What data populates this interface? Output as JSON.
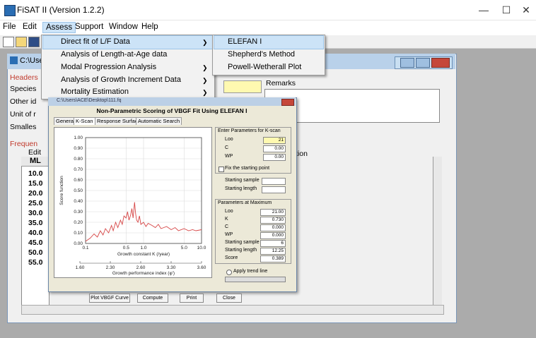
{
  "window": {
    "title": "FiSAT II (Version 1.2.2)",
    "minimize": "—",
    "maximize": "☐",
    "close": "✕"
  },
  "menubar": [
    "File",
    "Edit",
    "Assess",
    "Support",
    "Window",
    "Help"
  ],
  "assess_menu": [
    {
      "label": "Direct fit of L/F Data",
      "submenu": true
    },
    {
      "label": "Analysis of Length-at-Age data",
      "submenu": false
    },
    {
      "label": "Modal Progression Analysis",
      "submenu": true
    },
    {
      "label": "Analysis of Growth Increment Data",
      "submenu": true
    },
    {
      "label": "Mortality Estimation",
      "submenu": true
    }
  ],
  "direct_fit_submenu": [
    "ELEFAN I",
    "Shepherd's Method",
    "Powell-Wetherall Plot"
  ],
  "child": {
    "title": "C:\\Use",
    "headers_label": "Headers",
    "species_label": "Species",
    "other_label": "Other id",
    "unit_label": "Unit of r",
    "smallest_label": "Smalles",
    "remarks_label": "Remarks",
    "frequency_label": "Frequen",
    "edit_label": "Edit",
    "tion_label": "tion",
    "grid_header": "ML",
    "grid_values": [
      "10.0",
      "15.0",
      "20.0",
      "25.0",
      "30.0",
      "35.0",
      "40.0",
      "45.0",
      "50.0",
      "55.0"
    ]
  },
  "dialog": {
    "path": "C:\\Users\\ACE\\Desktop\\111.fq",
    "heading": "Non-Parametric Scoring of VBGF Fit Using ELEFAN I",
    "tabs": [
      "General",
      "K-Scan",
      "Response Surface",
      "Automatic Search"
    ],
    "k_scan_params_label": "Enter Parameters for K-scan",
    "loo_label": "Loo",
    "loo_value": "21",
    "c_label": "C",
    "c_value": "0.00",
    "wp_label": "WP",
    "wp_value": "0.00",
    "fix_start_label": "Fix the starting point",
    "start_sample_label": "Starting sample",
    "start_length_label": "Starting length",
    "params_max_label": "Parameters at Maximum",
    "max_loo_label": "Loo",
    "max_loo": "21.00",
    "max_k_label": "K",
    "max_k": "0.730",
    "max_c_label": "C",
    "max_c": "0.000",
    "max_wp_label": "WP",
    "max_wp": "0.000",
    "max_start_sample_label": "Starting sample",
    "max_start_sample": "6",
    "max_start_length_label": "Starting length",
    "max_start_length": "12.25",
    "score_label": "Score",
    "score": "0.389",
    "trend_label": "Apply trend line",
    "buttons": [
      "Plot VBGF Curve",
      "Compute",
      "Print",
      "Close"
    ]
  },
  "chart_data": {
    "type": "line",
    "xlabel": "Growth constant K (/year)",
    "x2label": "Growth performance index (φ')",
    "ylabel": "Score function",
    "x_ticks": [
      "0.1",
      "0.5",
      "1.0",
      "5.0",
      "10.0"
    ],
    "x2_ticks": [
      "1.60",
      "2.30",
      "2.60",
      "3.30",
      "3.60"
    ],
    "y_ticks": [
      "1.00",
      "0.90",
      "0.80",
      "0.70",
      "0.60",
      "0.50",
      "0.40",
      "0.30",
      "0.20",
      "0.10",
      "0.00"
    ],
    "ylim": [
      0,
      1
    ],
    "xlim_log": [
      0.1,
      10
    ],
    "x_scale": "log",
    "grid": true,
    "series": [
      {
        "color": "#d64545",
        "x": [
          0.1,
          0.12,
          0.14,
          0.16,
          0.18,
          0.2,
          0.22,
          0.25,
          0.28,
          0.3,
          0.33,
          0.36,
          0.4,
          0.43,
          0.46,
          0.5,
          0.53,
          0.56,
          0.6,
          0.63,
          0.66,
          0.7,
          0.73,
          0.76,
          0.8,
          0.85,
          0.9,
          1.0,
          1.1,
          1.2,
          1.4,
          1.6,
          1.8,
          2.0,
          2.5,
          3.0,
          3.5,
          4.0,
          5.0,
          6.0,
          7.0,
          8.0,
          10.0
        ],
        "y": [
          0.02,
          0.05,
          0.09,
          0.06,
          0.12,
          0.08,
          0.14,
          0.1,
          0.17,
          0.12,
          0.2,
          0.15,
          0.22,
          0.18,
          0.26,
          0.24,
          0.3,
          0.22,
          0.27,
          0.33,
          0.24,
          0.39,
          0.28,
          0.22,
          0.2,
          0.26,
          0.18,
          0.2,
          0.16,
          0.19,
          0.17,
          0.15,
          0.18,
          0.14,
          0.16,
          0.13,
          0.15,
          0.12,
          0.14,
          0.12,
          0.13,
          0.12,
          0.13
        ]
      }
    ]
  }
}
